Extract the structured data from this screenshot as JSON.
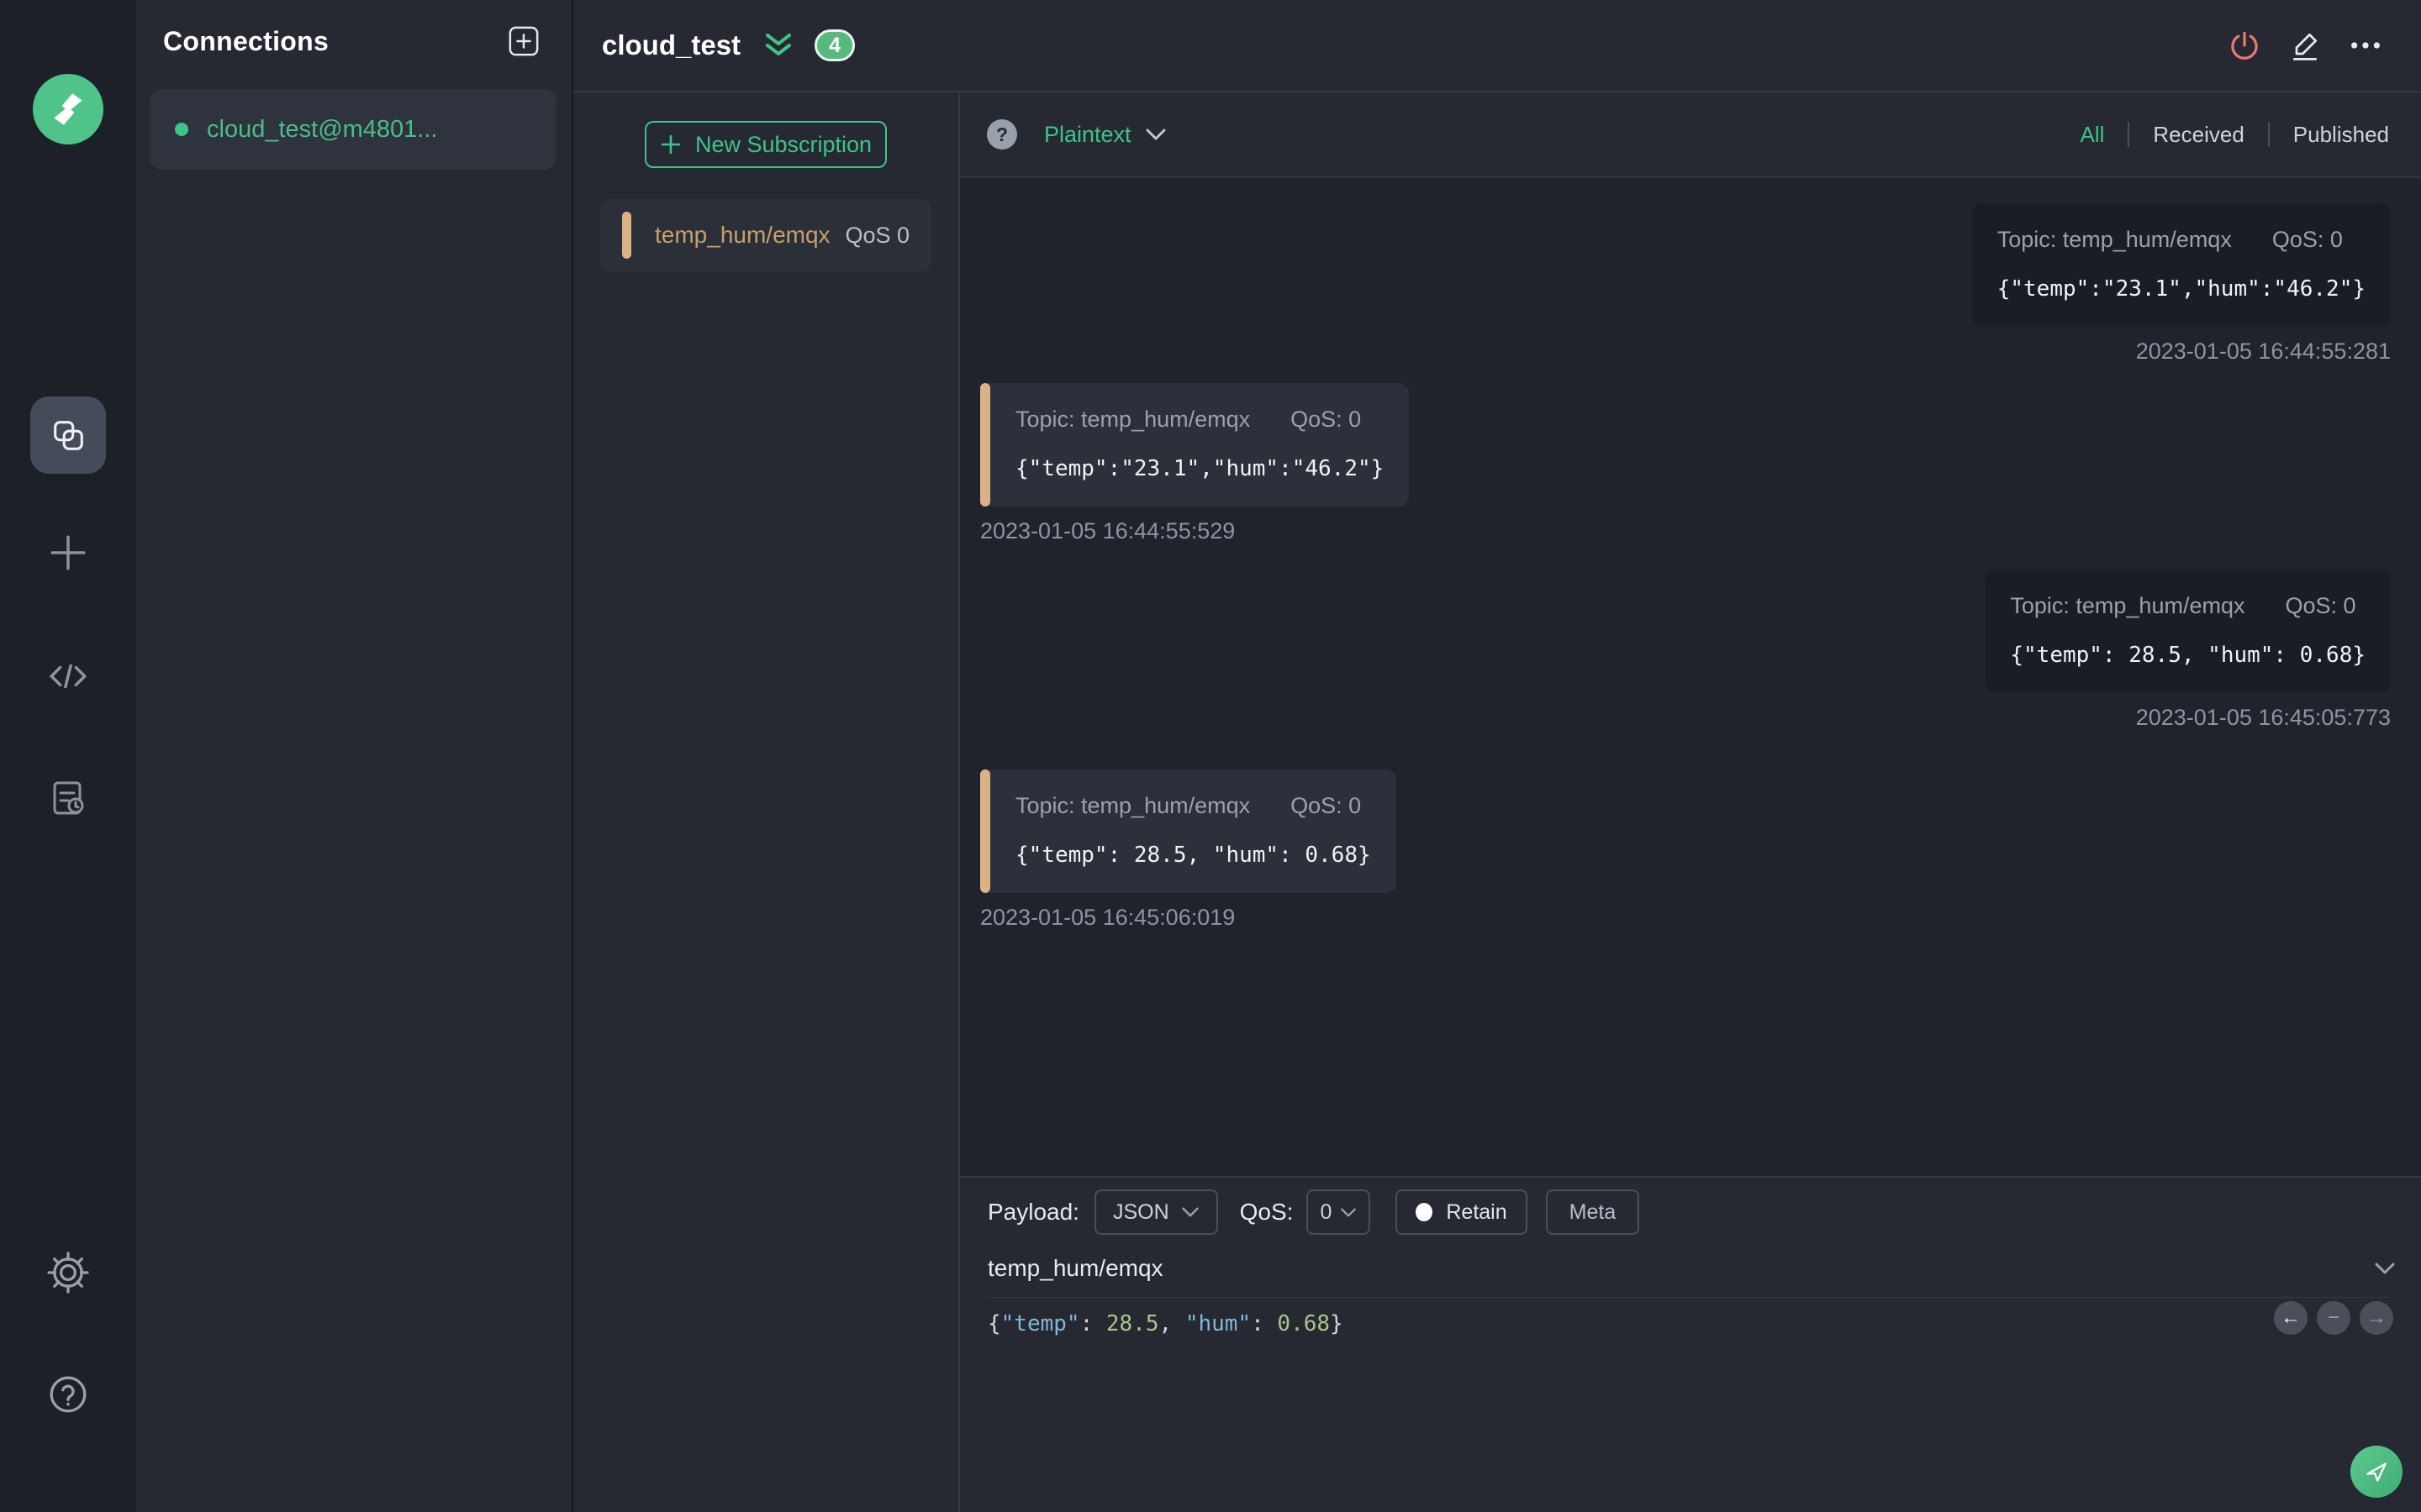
{
  "colors": {
    "accent_green": "#3ec487",
    "logo_green": "#4fc38a",
    "badge_green": "#56ba7e",
    "topic_tan": "#c7a06c",
    "marker_tan": "#d9b285",
    "power_red": "#e57a72"
  },
  "sidebar": {
    "logo_icon": "mqttx-logo",
    "nav": [
      {
        "icon": "connections-icon",
        "active": true
      },
      {
        "icon": "new-connection-plus-icon",
        "active": false
      },
      {
        "icon": "script-code-icon",
        "active": false
      },
      {
        "icon": "log-icon",
        "active": false
      }
    ],
    "footer": [
      {
        "icon": "settings-gear-icon"
      },
      {
        "icon": "help-question-icon"
      }
    ]
  },
  "connections": {
    "title": "Connections",
    "add_icon": "plus-square-icon",
    "items": [
      {
        "name": "cloud_test@m4801...",
        "status_color": "#3ec487",
        "connected": true
      }
    ]
  },
  "header": {
    "title": "cloud_test",
    "collapse_icon": "double-chevron-down-icon",
    "badge_count": "4",
    "actions": [
      {
        "icon": "power-icon",
        "color": "#e57a72"
      },
      {
        "icon": "edit-pencil-icon"
      },
      {
        "icon": "ellipsis-icon"
      }
    ]
  },
  "subscriptions": {
    "new_button_label": "New Subscription",
    "items": [
      {
        "topic": "temp_hum/emqx",
        "qos": "QoS 0"
      }
    ]
  },
  "messages": {
    "toolbar": {
      "help_icon": "question-circle-icon",
      "help_glyph": "?",
      "format": "Plaintext",
      "filters": [
        "All",
        "Received",
        "Published"
      ],
      "active_filter": "All"
    },
    "items": [
      {
        "direction": "published",
        "topic": "Topic: temp_hum/emqx",
        "qos": "QoS: 0",
        "payload": "{\"temp\":\"23.1\",\"hum\":\"46.2\"}",
        "timestamp": "2023-01-05 16:44:55:281"
      },
      {
        "direction": "received",
        "topic": "Topic: temp_hum/emqx",
        "qos": "QoS: 0",
        "payload": "{\"temp\":\"23.1\",\"hum\":\"46.2\"}",
        "timestamp": "2023-01-05 16:44:55:529"
      },
      {
        "direction": "published",
        "topic": "Topic: temp_hum/emqx",
        "qos": "QoS: 0",
        "payload": "{\"temp\": 28.5, \"hum\": 0.68}",
        "timestamp": "2023-01-05 16:45:05:773"
      },
      {
        "direction": "received",
        "topic": "Topic: temp_hum/emqx",
        "qos": "QoS: 0",
        "payload": "{\"temp\": 28.5, \"hum\": 0.68}",
        "timestamp": "2023-01-05 16:45:06:019"
      }
    ]
  },
  "publish": {
    "payload_label": "Payload:",
    "format_value": "JSON",
    "qos_label": "QoS:",
    "qos_value": "0",
    "retain_label": "Retain",
    "meta_label": "Meta",
    "topic_value": "temp_hum/emqx",
    "editor_tokens": [
      {
        "text": "{",
        "type": "punct"
      },
      {
        "text": "\"temp\"",
        "type": "key"
      },
      {
        "text": ": ",
        "type": "punct"
      },
      {
        "text": "28.5",
        "type": "number"
      },
      {
        "text": ", ",
        "type": "punct"
      },
      {
        "text": "\"hum\"",
        "type": "key"
      },
      {
        "text": ": ",
        "type": "punct"
      },
      {
        "text": "0.68",
        "type": "number"
      },
      {
        "text": "}",
        "type": "punct"
      }
    ],
    "history_nav": [
      {
        "icon": "arrow-left-icon",
        "glyph": "←"
      },
      {
        "icon": "minus-icon",
        "glyph": "−"
      },
      {
        "icon": "arrow-right-icon",
        "glyph": "→"
      }
    ],
    "send_icon": "send-icon"
  }
}
